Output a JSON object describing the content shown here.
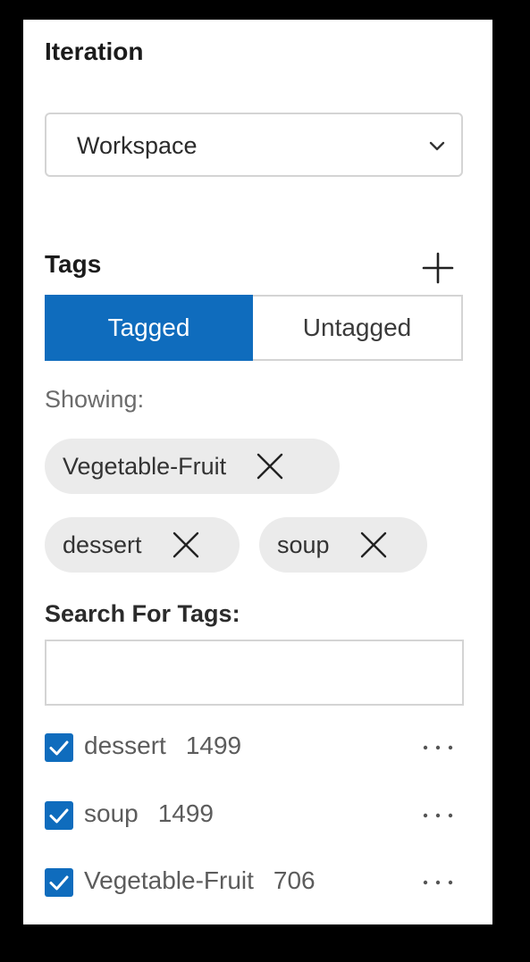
{
  "iteration": {
    "title": "Iteration",
    "selected": "Workspace"
  },
  "tags": {
    "title": "Tags",
    "toggle": {
      "tagged_label": "Tagged",
      "untagged_label": "Untagged",
      "active": "Tagged"
    },
    "showing_label": "Showing:",
    "active_filters": [
      {
        "label": "Vegetable-Fruit"
      },
      {
        "label": "dessert"
      },
      {
        "label": "soup"
      }
    ],
    "search_label": "Search For Tags:",
    "search_value": "",
    "list": [
      {
        "name": "dessert",
        "count": "1499",
        "checked": true
      },
      {
        "name": "soup",
        "count": "1499",
        "checked": true
      },
      {
        "name": "Vegetable-Fruit",
        "count": "706",
        "checked": true
      }
    ]
  },
  "icons": {
    "select_chevron": "chevron-down-icon",
    "add": "plus-icon",
    "chip_remove": "close-icon",
    "checkbox": "checkmark-icon",
    "row_more": "more-horizontal-icon"
  },
  "colors": {
    "accent": "#0f6cbd",
    "chip_bg": "#ebebeb",
    "border": "#d4d4d4",
    "frame": "#000000"
  }
}
